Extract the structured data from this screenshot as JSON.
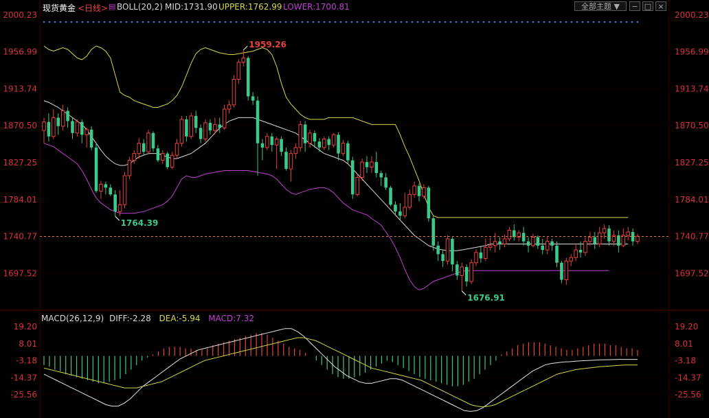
{
  "header": {
    "symbol": "现货黄金",
    "period": "<日线>",
    "boll_label": "BOLL(20,2)",
    "mid": "MID:1731.90",
    "upper": "UPPER:1762.99",
    "lower": "LOWER:1700.81",
    "theme_button": "全部主题",
    "icon_buttons": [
      "minus-icon",
      "square-icon",
      "close-icon"
    ]
  },
  "colors": {
    "background": "#000000",
    "grid": "#3a0000",
    "up": "#e8433b",
    "down": "#3cc98a",
    "mid_line": "#d9d9d9",
    "upper_line": "#d8d84a",
    "lower_line": "#c040d0",
    "axis_text": "#d9313b",
    "dots": "#2f86e0"
  },
  "price_axis": {
    "labels": [
      "2000.23",
      "1956.99",
      "1913.74",
      "1870.50",
      "1827.25",
      "1784.01",
      "1740.77",
      "1697.52"
    ],
    "range": [
      1654.28,
      2000.23
    ],
    "current_price": "1740.77"
  },
  "annotations": {
    "high": "1959.26",
    "low_left": "1764.39",
    "low_right": "1676.91"
  },
  "macd": {
    "label": "MACD(26,12,9)",
    "diff": "DIFF:-2.28",
    "dea": "DEA:-5.94",
    "macd": "MACD:7.32",
    "axis_labels": [
      "19.20",
      "8.01",
      "-3.18",
      "-14.37",
      "-25.56"
    ],
    "range": [
      -36.75,
      19.2
    ]
  },
  "chart_data": {
    "type": "candlestick",
    "candles": [
      [
        1865.0,
        1875.0,
        1850.0,
        1880.0
      ],
      [
        1875.0,
        1858.0,
        1852.0,
        1885.0
      ],
      [
        1858.0,
        1880.0,
        1855.0,
        1890.0
      ],
      [
        1880.0,
        1870.0,
        1860.0,
        1885.0
      ],
      [
        1870.0,
        1888.0,
        1865.0,
        1895.0
      ],
      [
        1888.0,
        1876.0,
        1868.0,
        1892.0
      ],
      [
        1876.0,
        1862.0,
        1855.0,
        1880.0
      ],
      [
        1862.0,
        1875.0,
        1858.0,
        1878.0
      ],
      [
        1875.0,
        1860.0,
        1850.0,
        1878.0
      ],
      [
        1860.0,
        1866.0,
        1845.0,
        1868.0
      ],
      [
        1866.0,
        1845.0,
        1842.0,
        1870.0
      ],
      [
        1845.0,
        1794.0,
        1792.0,
        1850.0
      ],
      [
        1794.0,
        1802.0,
        1785.0,
        1806.0
      ],
      [
        1802.0,
        1798.0,
        1790.0,
        1805.0
      ],
      [
        1798.0,
        1790.0,
        1788.0,
        1802.0
      ],
      [
        1790.0,
        1770.0,
        1764.39,
        1795.0
      ],
      [
        1770.0,
        1778.0,
        1765.0,
        1795.0
      ],
      [
        1778.0,
        1812.0,
        1774.0,
        1816.0
      ],
      [
        1812.0,
        1830.0,
        1808.0,
        1834.0
      ],
      [
        1830.0,
        1838.0,
        1826.0,
        1842.0
      ],
      [
        1838.0,
        1850.0,
        1832.0,
        1856.0
      ],
      [
        1850.0,
        1840.0,
        1836.0,
        1855.0
      ],
      [
        1840.0,
        1862.0,
        1837.0,
        1866.0
      ],
      [
        1862.0,
        1844.0,
        1840.0,
        1864.0
      ],
      [
        1844.0,
        1830.0,
        1828.0,
        1848.0
      ],
      [
        1830.0,
        1838.0,
        1826.0,
        1842.0
      ],
      [
        1838.0,
        1822.0,
        1820.0,
        1840.0
      ],
      [
        1822.0,
        1836.0,
        1820.0,
        1840.0
      ],
      [
        1836.0,
        1850.0,
        1832.0,
        1855.0
      ],
      [
        1850.0,
        1878.0,
        1846.0,
        1882.0
      ],
      [
        1878.0,
        1858.0,
        1852.0,
        1882.0
      ],
      [
        1858.0,
        1882.0,
        1855.0,
        1886.0
      ],
      [
        1882.0,
        1868.0,
        1862.0,
        1888.0
      ],
      [
        1868.0,
        1855.0,
        1850.0,
        1872.0
      ],
      [
        1855.0,
        1874.0,
        1852.0,
        1878.0
      ],
      [
        1874.0,
        1865.0,
        1860.0,
        1878.0
      ],
      [
        1865.0,
        1872.0,
        1860.0,
        1880.0
      ],
      [
        1872.0,
        1868.0,
        1862.0,
        1880.0
      ],
      [
        1868.0,
        1890.0,
        1866.0,
        1895.0
      ],
      [
        1890.0,
        1895.0,
        1885.0,
        1900.0
      ],
      [
        1895.0,
        1925.0,
        1892.0,
        1930.0
      ],
      [
        1925.0,
        1945.0,
        1920.0,
        1948.0
      ],
      [
        1945.0,
        1950.0,
        1940.0,
        1959.26
      ],
      [
        1950.0,
        1905.0,
        1900.0,
        1952.0
      ],
      [
        1905.0,
        1900.0,
        1895.0,
        1910.0
      ],
      [
        1900.0,
        1850.0,
        1812.0,
        1905.0
      ],
      [
        1850.0,
        1845.0,
        1830.0,
        1855.0
      ],
      [
        1845.0,
        1858.0,
        1842.0,
        1862.0
      ],
      [
        1858.0,
        1848.0,
        1840.0,
        1862.0
      ],
      [
        1848.0,
        1855.0,
        1820.0,
        1858.0
      ],
      [
        1855.0,
        1840.0,
        1835.0,
        1858.0
      ],
      [
        1840.0,
        1820.0,
        1818.0,
        1845.0
      ],
      [
        1820.0,
        1838.0,
        1805.0,
        1842.0
      ],
      [
        1838.0,
        1845.0,
        1832.0,
        1850.0
      ],
      [
        1845.0,
        1872.0,
        1840.0,
        1876.0
      ],
      [
        1872.0,
        1850.0,
        1840.0,
        1876.0
      ],
      [
        1850.0,
        1862.0,
        1845.0,
        1866.0
      ],
      [
        1862.0,
        1852.0,
        1845.0,
        1865.0
      ],
      [
        1852.0,
        1845.0,
        1840.0,
        1856.0
      ],
      [
        1845.0,
        1855.0,
        1842.0,
        1858.0
      ],
      [
        1855.0,
        1848.0,
        1842.0,
        1858.0
      ],
      [
        1848.0,
        1860.0,
        1845.0,
        1862.0
      ],
      [
        1860.0,
        1838.0,
        1830.0,
        1863.0
      ],
      [
        1838.0,
        1850.0,
        1835.0,
        1854.0
      ],
      [
        1850.0,
        1830.0,
        1826.0,
        1853.0
      ],
      [
        1830.0,
        1790.0,
        1785.0,
        1834.0
      ],
      [
        1790.0,
        1810.0,
        1788.0,
        1814.0
      ],
      [
        1810.0,
        1828.0,
        1806.0,
        1832.0
      ],
      [
        1828.0,
        1822.0,
        1815.0,
        1835.0
      ],
      [
        1822.0,
        1828.0,
        1815.0,
        1835.0
      ],
      [
        1828.0,
        1815.0,
        1810.0,
        1840.0
      ],
      [
        1815.0,
        1810.0,
        1800.0,
        1818.0
      ],
      [
        1810.0,
        1798.0,
        1795.0,
        1815.0
      ],
      [
        1798.0,
        1778.0,
        1776.0,
        1800.0
      ],
      [
        1778.0,
        1770.0,
        1765.0,
        1782.0
      ],
      [
        1770.0,
        1765.0,
        1760.0,
        1780.0
      ],
      [
        1765.0,
        1775.0,
        1762.0,
        1792.0
      ],
      [
        1775.0,
        1790.0,
        1772.0,
        1796.0
      ],
      [
        1790.0,
        1800.0,
        1786.0,
        1805.0
      ],
      [
        1800.0,
        1788.0,
        1782.0,
        1803.0
      ],
      [
        1788.0,
        1798.0,
        1785.0,
        1802.0
      ],
      [
        1798.0,
        1762.0,
        1758.0,
        1800.0
      ],
      [
        1762.0,
        1730.0,
        1724.0,
        1765.0
      ],
      [
        1730.0,
        1720.0,
        1712.0,
        1735.0
      ],
      [
        1720.0,
        1712.0,
        1705.0,
        1725.0
      ],
      [
        1712.0,
        1738.0,
        1708.0,
        1742.0
      ],
      [
        1738.0,
        1708.0,
        1700.0,
        1740.0
      ],
      [
        1708.0,
        1695.0,
        1690.0,
        1712.0
      ],
      [
        1695.0,
        1705.0,
        1676.91,
        1710.0
      ],
      [
        1705.0,
        1688.0,
        1682.0,
        1708.0
      ],
      [
        1688.0,
        1710.0,
        1685.0,
        1714.0
      ],
      [
        1710.0,
        1722.0,
        1706.0,
        1726.0
      ],
      [
        1722.0,
        1715.0,
        1710.0,
        1730.0
      ],
      [
        1715.0,
        1728.0,
        1712.0,
        1738.0
      ],
      [
        1728.0,
        1730.0,
        1724.0,
        1740.0
      ],
      [
        1730.0,
        1735.0,
        1722.0,
        1745.0
      ],
      [
        1735.0,
        1732.0,
        1725.0,
        1740.0
      ],
      [
        1732.0,
        1738.0,
        1728.0,
        1743.0
      ],
      [
        1738.0,
        1748.0,
        1735.0,
        1752.0
      ],
      [
        1748.0,
        1740.0,
        1736.0,
        1755.0
      ],
      [
        1740.0,
        1745.0,
        1735.0,
        1748.0
      ],
      [
        1745.0,
        1735.0,
        1730.0,
        1752.0
      ],
      [
        1735.0,
        1730.0,
        1722.0,
        1740.0
      ],
      [
        1730.0,
        1740.0,
        1728.0,
        1744.0
      ],
      [
        1740.0,
        1730.0,
        1726.0,
        1742.0
      ],
      [
        1730.0,
        1725.0,
        1720.0,
        1738.0
      ],
      [
        1725.0,
        1735.0,
        1720.0,
        1740.0
      ],
      [
        1735.0,
        1730.0,
        1724.0,
        1738.0
      ],
      [
        1730.0,
        1710.0,
        1705.0,
        1735.0
      ],
      [
        1710.0,
        1690.0,
        1686.0,
        1712.0
      ],
      [
        1690.0,
        1712.0,
        1684.0,
        1716.0
      ],
      [
        1712.0,
        1716.0,
        1706.0,
        1720.0
      ],
      [
        1716.0,
        1725.0,
        1712.0,
        1732.0
      ],
      [
        1725.0,
        1722.0,
        1716.0,
        1735.0
      ],
      [
        1722.0,
        1735.0,
        1718.0,
        1740.0
      ],
      [
        1735.0,
        1740.0,
        1730.0,
        1746.0
      ],
      [
        1740.0,
        1732.0,
        1726.0,
        1746.0
      ],
      [
        1732.0,
        1745.0,
        1728.0,
        1752.0
      ],
      [
        1745.0,
        1750.0,
        1738.0,
        1755.0
      ],
      [
        1750.0,
        1735.0,
        1730.0,
        1754.0
      ],
      [
        1735.0,
        1742.0,
        1730.0,
        1748.0
      ],
      [
        1742.0,
        1730.0,
        1722.0,
        1748.0
      ],
      [
        1730.0,
        1742.0,
        1728.0,
        1750.0
      ],
      [
        1742.0,
        1746.0,
        1736.0,
        1752.0
      ],
      [
        1746.0,
        1735.0,
        1730.0,
        1750.0
      ],
      [
        1735.0,
        1741.0,
        1732.0,
        1744.0
      ]
    ],
    "mid": [
      1900,
      1898,
      1895,
      1892,
      1888,
      1884,
      1880,
      1876,
      1872,
      1866,
      1858,
      1850,
      1842,
      1835,
      1830,
      1826,
      1824,
      1824,
      1826,
      1830,
      1834,
      1836,
      1838,
      1838,
      1838,
      1836,
      1834,
      1832,
      1832,
      1834,
      1836,
      1838,
      1842,
      1846,
      1850,
      1856,
      1862,
      1868,
      1872,
      1876,
      1878,
      1880,
      1880,
      1880,
      1880,
      1878,
      1876,
      1874,
      1872,
      1870,
      1868,
      1866,
      1864,
      1862,
      1858,
      1854,
      1850,
      1846,
      1842,
      1838,
      1836,
      1834,
      1832,
      1830,
      1826,
      1820,
      1814,
      1808,
      1802,
      1796,
      1790,
      1784,
      1778,
      1772,
      1766,
      1760,
      1754,
      1748,
      1742,
      1738,
      1734,
      1730,
      1728,
      1726,
      1725,
      1724,
      1724,
      1724,
      1725,
      1726,
      1727,
      1728,
      1729,
      1730,
      1731.9,
      1731.9,
      1731.9,
      1731.9,
      1731.9,
      1731.9,
      1731.9,
      1731.9,
      1731.9,
      1731.9,
      1731.9,
      1731.9,
      1731.9,
      1731.9,
      1731.9,
      1731.9,
      1731.9,
      1731.9,
      1731.9,
      1731.9,
      1731.9,
      1731.9,
      1731.9,
      1731.9,
      1731.9,
      1731.9,
      1731.9,
      1731.9,
      1731.9,
      1731.9
    ],
    "upper": [
      1964,
      1960,
      1958,
      1960,
      1962,
      1960,
      1955,
      1950,
      1948,
      1952,
      1960,
      1964,
      1962,
      1958,
      1950,
      1930,
      1910,
      1906,
      1904,
      1900,
      1898,
      1896,
      1894,
      1892,
      1892,
      1894,
      1896,
      1900,
      1906,
      1916,
      1930,
      1944,
      1955,
      1960,
      1962,
      1960,
      1958,
      1956,
      1955,
      1954,
      1954,
      1955,
      1956,
      1957,
      1958,
      1960,
      1962,
      1960,
      1954,
      1940,
      1920,
      1904,
      1896,
      1890,
      1884,
      1880,
      1878,
      1878,
      1878,
      1878,
      1880,
      1880,
      1880,
      1880,
      1880,
      1880,
      1878,
      1876,
      1874,
      1872,
      1872,
      1872,
      1872,
      1872,
      1872,
      1860,
      1846,
      1834,
      1820,
      1806,
      1790,
      1775,
      1765,
      1763,
      1762.99,
      1762.99,
      1762.99,
      1762.99,
      1762.99,
      1762.99,
      1762.99,
      1762.99,
      1762.99,
      1762.99,
      1762.99,
      1762.99,
      1762.99,
      1762.99,
      1762.99,
      1762.99,
      1762.99,
      1762.99,
      1762.99,
      1762.99,
      1762.99,
      1762.99,
      1762.99,
      1762.99,
      1762.99,
      1762.99,
      1762.99,
      1762.99,
      1762.99,
      1762.99,
      1762.99,
      1762.99,
      1762.99,
      1762.99,
      1762.99,
      1762.99,
      1762.99,
      1762.99,
      1762.99,
      1762.99
    ],
    "lower": [
      1850,
      1848,
      1846,
      1842,
      1838,
      1834,
      1830,
      1826,
      1818,
      1808,
      1796,
      1786,
      1780,
      1776,
      1772,
      1770,
      1768,
      1768,
      1768,
      1768,
      1769,
      1770,
      1772,
      1774,
      1776,
      1778,
      1782,
      1788,
      1798,
      1808,
      1812,
      1810,
      1810,
      1812,
      1814,
      1815,
      1816,
      1817,
      1818,
      1818,
      1818,
      1818,
      1818,
      1818,
      1817,
      1816,
      1815,
      1814,
      1812,
      1808,
      1802,
      1796,
      1792,
      1790,
      1792,
      1794,
      1796,
      1797,
      1798,
      1798,
      1796,
      1792,
      1786,
      1780,
      1776,
      1772,
      1770,
      1768,
      1766,
      1762,
      1758,
      1754,
      1746,
      1738,
      1728,
      1716,
      1702,
      1690,
      1682,
      1678,
      1680,
      1684,
      1688,
      1690,
      1692,
      1694,
      1696,
      1698,
      1700,
      1700.81,
      1700.81,
      1700.81,
      1700.81,
      1700.81,
      1700.81,
      1700.81,
      1700.81,
      1700.81,
      1700.81,
      1700.81,
      1700.81,
      1700.81,
      1700.81,
      1700.81,
      1700.81,
      1700.81,
      1700.81,
      1700.81,
      1700.81,
      1700.81,
      1700.81,
      1700.81,
      1700.81,
      1700.81,
      1700.81,
      1700.81,
      1700.81,
      1700.81,
      1700.81,
      1700.81
    ],
    "macd_hist": [
      -6,
      -7,
      -9,
      -10,
      -12,
      -13,
      -14,
      -15,
      -16,
      -17,
      -18,
      -18,
      -17,
      -16,
      -15,
      -12,
      -9,
      -6,
      -3,
      -1,
      1,
      3,
      5,
      6,
      6,
      6,
      5,
      5,
      4,
      4,
      5,
      7,
      8,
      9,
      10,
      11,
      12,
      13,
      14,
      15,
      15,
      14,
      12,
      10,
      8,
      6,
      5,
      4,
      2,
      0,
      -3,
      -6,
      -9,
      -12,
      -14,
      -15,
      -15,
      -14,
      -13,
      -11,
      -9,
      -7,
      -5,
      -3,
      -4,
      -6,
      -8,
      -10,
      -12,
      -14,
      -15,
      -16,
      -17,
      -18,
      -19,
      -20,
      -20,
      -19,
      -17,
      -15,
      -12,
      -9,
      -6,
      -3,
      1,
      3,
      5,
      7,
      8,
      9,
      9,
      9,
      8,
      7,
      6,
      5,
      4,
      4,
      5,
      6,
      7,
      8,
      8,
      8,
      7,
      7,
      6,
      5,
      5,
      4
    ],
    "diff": [
      -12,
      -14,
      -16,
      -18,
      -20,
      -22,
      -24,
      -26,
      -28,
      -30,
      -32,
      -33,
      -33,
      -31,
      -28,
      -24,
      -20,
      -17,
      -14,
      -11,
      -8,
      -5,
      -2,
      0,
      2,
      4,
      5,
      6,
      7,
      8,
      9,
      10,
      11,
      12,
      13,
      14,
      15,
      16,
      17,
      18,
      18,
      16,
      13,
      9,
      5,
      1,
      -3,
      -7,
      -10,
      -13,
      -15,
      -17,
      -18,
      -18,
      -17,
      -16,
      -15,
      -15,
      -16,
      -18,
      -20,
      -22,
      -24,
      -26,
      -28,
      -30,
      -32,
      -34,
      -36,
      -36.5,
      -36,
      -34,
      -31,
      -28,
      -25,
      -22,
      -19,
      -16,
      -13,
      -10,
      -8,
      -6,
      -5,
      -4.5,
      -4,
      -3.8,
      -3.5,
      -3.2,
      -3.0,
      -2.8,
      -2.6,
      -2.5,
      -2.4,
      -2.3,
      -2.28,
      -2.28,
      -2.28
    ],
    "dea": [
      -8,
      -9,
      -10,
      -11,
      -12,
      -13,
      -14,
      -15,
      -16,
      -17,
      -18,
      -19,
      -20,
      -21,
      -21,
      -21,
      -20,
      -19,
      -18,
      -17,
      -15,
      -13,
      -11,
      -9,
      -7,
      -5,
      -3,
      -2,
      -1,
      0,
      1,
      2,
      3,
      4,
      5,
      6,
      7,
      8,
      9,
      10,
      11,
      12,
      12,
      11,
      10,
      8,
      6,
      4,
      2,
      0,
      -2,
      -4,
      -6,
      -8,
      -9,
      -10,
      -11,
      -12,
      -13,
      -14,
      -15,
      -16,
      -18,
      -20,
      -22,
      -24,
      -26,
      -28,
      -30,
      -32,
      -33,
      -33.5,
      -33,
      -32,
      -30,
      -28,
      -26,
      -24,
      -22,
      -20,
      -18,
      -16,
      -14,
      -12,
      -11,
      -10,
      -9,
      -8.5,
      -8,
      -7.5,
      -7,
      -6.8,
      -6.5,
      -6.2,
      -6.0,
      -5.94,
      -5.94
    ]
  }
}
